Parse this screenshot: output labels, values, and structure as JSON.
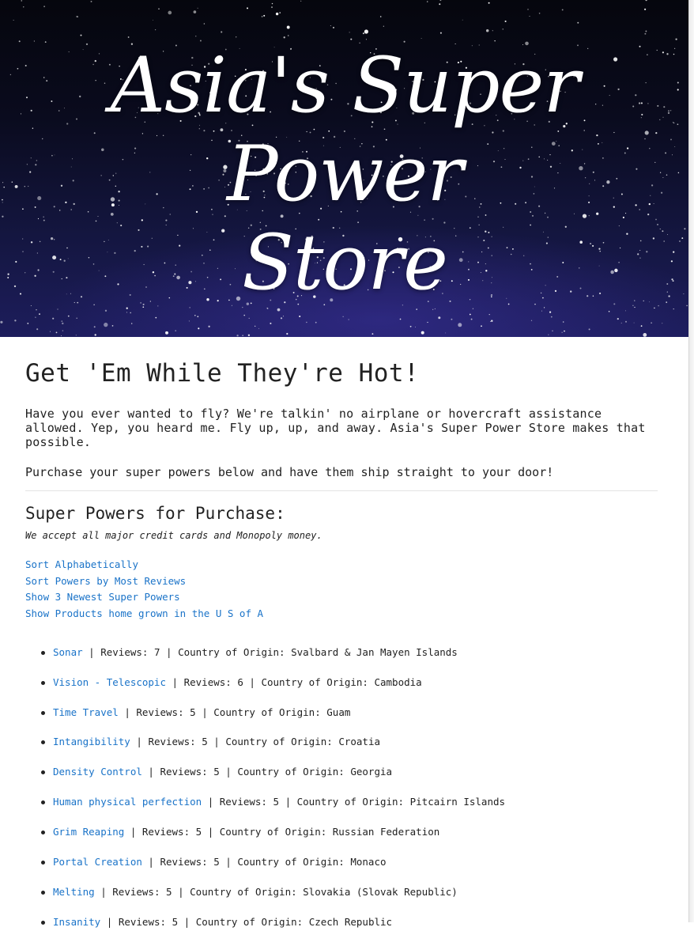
{
  "hero": {
    "title_line1": "Asia's Super Power",
    "title_line2": "Store"
  },
  "intro": {
    "heading": "Get 'Em While They're Hot!",
    "paragraph1": "Have you ever wanted to fly? We're talkin' no airplane or hovercraft assistance allowed. Yep, you heard me. Fly up, up, and away. Asia's Super Power Store makes that possible.",
    "paragraph2": "Purchase your super powers below and have them ship straight to your door!"
  },
  "catalog": {
    "heading": "Super Powers for Purchase:",
    "payment_note": "We accept all major credit cards and Monopoly money.",
    "sort_links": [
      "Sort Alphabetically",
      "Sort Powers by Most Reviews",
      "Show 3 Newest Super Powers",
      "Show Products home grown in the U S of A"
    ],
    "reviews_label": "Reviews:",
    "origin_label": "Country of Origin:",
    "separator": "|",
    "products": [
      {
        "name": "Sonar",
        "reviews": "7",
        "origin": "Svalbard & Jan Mayen Islands"
      },
      {
        "name": "Vision - Telescopic",
        "reviews": "6",
        "origin": "Cambodia"
      },
      {
        "name": "Time Travel",
        "reviews": "5",
        "origin": "Guam"
      },
      {
        "name": "Intangibility",
        "reviews": "5",
        "origin": "Croatia"
      },
      {
        "name": "Density Control",
        "reviews": "5",
        "origin": "Georgia"
      },
      {
        "name": "Human physical perfection",
        "reviews": "5",
        "origin": "Pitcairn Islands"
      },
      {
        "name": "Grim Reaping",
        "reviews": "5",
        "origin": "Russian Federation"
      },
      {
        "name": "Portal Creation",
        "reviews": "5",
        "origin": "Monaco"
      },
      {
        "name": "Melting",
        "reviews": "5",
        "origin": "Slovakia (Slovak Republic)"
      },
      {
        "name": "Insanity",
        "reviews": "5",
        "origin": "Czech Republic"
      }
    ]
  },
  "colors": {
    "link": "#1a73c8",
    "text": "#222222",
    "hero_sky": "#0a0b1e"
  }
}
